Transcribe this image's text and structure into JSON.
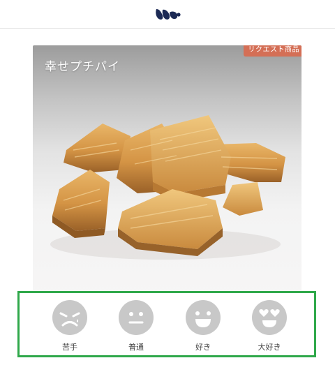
{
  "header": {
    "logo_icon": "brand-logo-icon"
  },
  "product": {
    "name": "幸せプチパイ",
    "badge": "リクエスト商品",
    "photo_icon": "pastry-photo"
  },
  "rating": {
    "options": [
      {
        "label": "苦手",
        "icon": "sad-face-icon"
      },
      {
        "label": "普通",
        "icon": "neutral-face-icon"
      },
      {
        "label": "好き",
        "icon": "happy-face-icon"
      },
      {
        "label": "大好き",
        "icon": "heart-eyes-face-icon"
      }
    ]
  },
  "colors": {
    "badge": "#d46f56",
    "highlight_border": "#2fa84a",
    "logo": "#1c2a55",
    "face": "#c8c8c8"
  }
}
